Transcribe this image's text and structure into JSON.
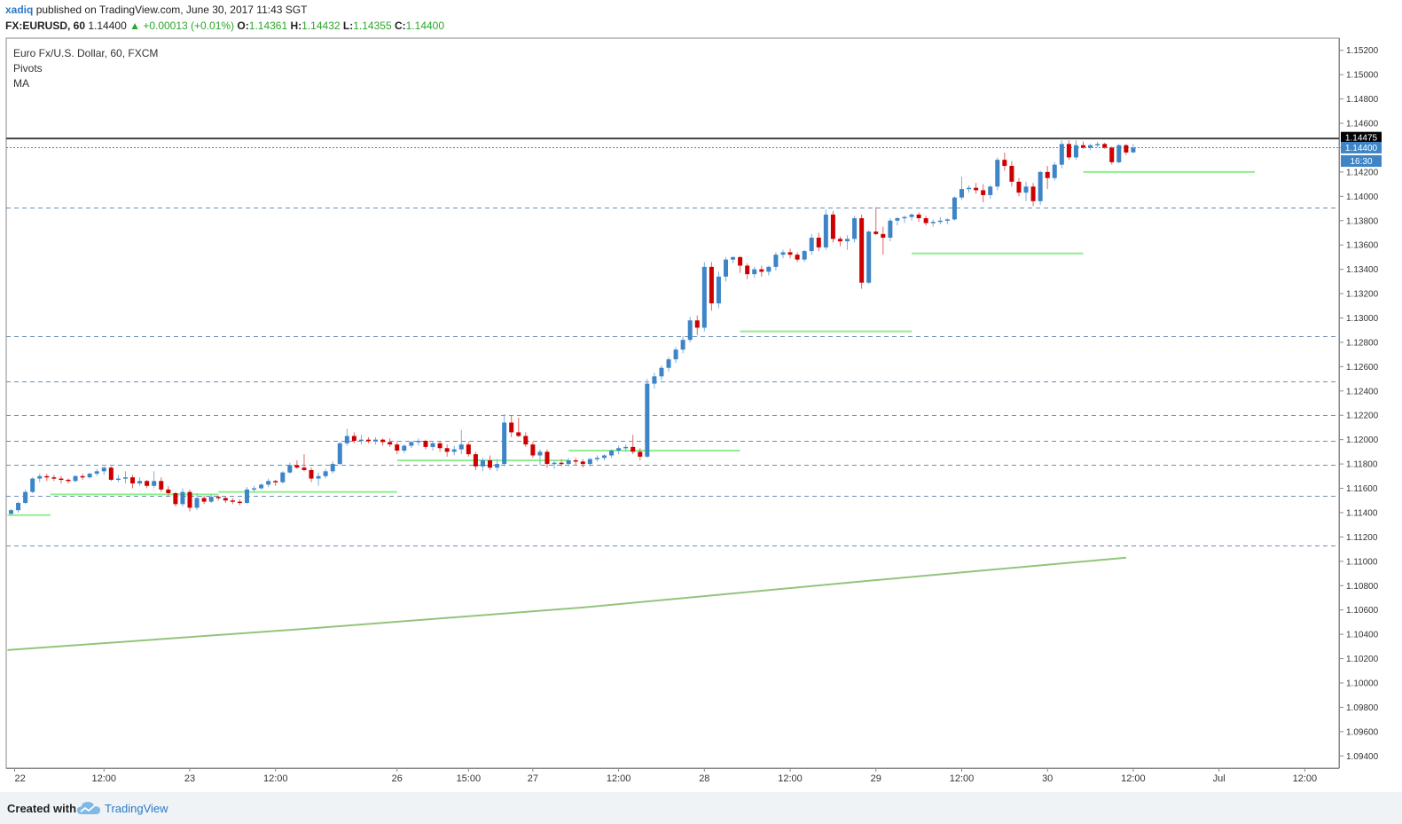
{
  "header": {
    "user": "xadiq",
    "published": "published on TradingView.com, June 30, 2017 11:43 SGT",
    "symbol": "FX:EURUSD, 60",
    "last": "1.14400",
    "change": "▲ +0.00013 (+0.01%)",
    "o_label": "O:",
    "o_value": "1.14361",
    "h_label": "H:",
    "h_value": "1.14432",
    "l_label": "L:",
    "l_value": "1.14355",
    "c_label": "C:",
    "c_value": "1.14400"
  },
  "legend": {
    "title": "Euro Fx/U.S. Dollar, 60, FXCM",
    "indicator1": "Pivots",
    "indicator2": "MA"
  },
  "footer": {
    "created": "Created with",
    "brand": "TradingView"
  },
  "colors": {
    "up": "#3d85c6",
    "down": "#cc0000",
    "wick_up": "#7aaee0",
    "wick_down": "#e06666",
    "pivot": "#90ee90",
    "ma": "#93c47d",
    "dashed": "#6d8fb0",
    "resistance": "#434343"
  },
  "chart_data": {
    "type": "candlestick",
    "symbol": "FX:EURUSD",
    "interval": "60",
    "ylim": [
      1.093,
      1.153
    ],
    "yticks": [
      "1.15200",
      "1.15000",
      "1.14800",
      "1.14600",
      "1.14400",
      "1.14200",
      "1.14000",
      "1.13800",
      "1.13600",
      "1.13400",
      "1.13200",
      "1.13000",
      "1.12800",
      "1.12600",
      "1.12400",
      "1.12200",
      "1.12000",
      "1.11800",
      "1.11600",
      "1.11400",
      "1.11200",
      "1.11000",
      "1.10800",
      "1.10600",
      "1.10400",
      "1.10200",
      "1.10000",
      "1.09800",
      "1.09600",
      "1.09400"
    ],
    "xlim": [
      0,
      157
    ],
    "xticks": [
      {
        "i": 0.5,
        "label": "22"
      },
      {
        "i": 13,
        "label": "12:00"
      },
      {
        "i": 25,
        "label": "23"
      },
      {
        "i": 37,
        "label": "12:00"
      },
      {
        "i": 54,
        "label": "26"
      },
      {
        "i": 64,
        "label": "15:00"
      },
      {
        "i": 73,
        "label": "27"
      },
      {
        "i": 85,
        "label": "12:00"
      },
      {
        "i": 97,
        "label": "28"
      },
      {
        "i": 109,
        "label": "12:00"
      },
      {
        "i": 121,
        "label": "29"
      },
      {
        "i": 133,
        "label": "12:00"
      },
      {
        "i": 145,
        "label": "30"
      },
      {
        "i": 157,
        "label": "12:00"
      },
      {
        "i": 169,
        "label": "Jul"
      },
      {
        "i": 181,
        "label": "12:00"
      }
    ],
    "price_markers": [
      {
        "label": "1.14475",
        "value": 1.14475,
        "bg": "#000000",
        "fg": "#ffffff"
      },
      {
        "label": "1.14400",
        "value": 1.144,
        "bg": "#3d85c6",
        "fg": "#ffffff"
      },
      {
        "label": "16:30",
        "value": 1.1429,
        "bg": "#3d85c6",
        "fg": "#ffffff"
      }
    ],
    "resistance": 1.14475,
    "last_price": 1.144,
    "dashed_levels": [
      1.1391,
      1.1285,
      1.1248,
      1.122,
      1.1199,
      1.1179,
      1.1154,
      1.1113
    ],
    "pivots": [
      {
        "from": -0.5,
        "to": 5.5,
        "value": 1.1138
      },
      {
        "from": 5.5,
        "to": 29,
        "value": 1.1155
      },
      {
        "from": 29,
        "to": 54,
        "value": 1.1157
      },
      {
        "from": 54,
        "to": 78,
        "value": 1.1183
      },
      {
        "from": 78,
        "to": 102,
        "value": 1.1191
      },
      {
        "from": 102,
        "to": 126,
        "value": 1.1289
      },
      {
        "from": 126,
        "to": 150,
        "value": 1.1353
      },
      {
        "from": 150,
        "to": 174,
        "value": 1.142
      }
    ],
    "ma": [
      {
        "i": -0.5,
        "value": 1.1027
      },
      {
        "i": 40,
        "value": 1.1044
      },
      {
        "i": 80,
        "value": 1.1062
      },
      {
        "i": 120,
        "value": 1.1084
      },
      {
        "i": 156,
        "value": 1.1103
      }
    ],
    "candles": [
      [
        1.1139,
        1.1143,
        1.1138,
        1.1142
      ],
      [
        1.1142,
        1.1149,
        1.114,
        1.1148
      ],
      [
        1.1148,
        1.1159,
        1.1147,
        1.1157
      ],
      [
        1.1157,
        1.1169,
        1.1156,
        1.1168
      ],
      [
        1.1168,
        1.1172,
        1.1165,
        1.117
      ],
      [
        1.117,
        1.1172,
        1.1166,
        1.1169
      ],
      [
        1.1169,
        1.1171,
        1.1166,
        1.1168
      ],
      [
        1.1168,
        1.117,
        1.1164,
        1.1167
      ],
      [
        1.1167,
        1.1168,
        1.1164,
        1.1166
      ],
      [
        1.1166,
        1.1171,
        1.1165,
        1.117
      ],
      [
        1.117,
        1.1172,
        1.1167,
        1.1169
      ],
      [
        1.1169,
        1.1173,
        1.1168,
        1.1172
      ],
      [
        1.1172,
        1.1176,
        1.117,
        1.1174
      ],
      [
        1.1174,
        1.1178,
        1.1171,
        1.1177
      ],
      [
        1.1177,
        1.1178,
        1.1166,
        1.1167
      ],
      [
        1.1167,
        1.1171,
        1.1165,
        1.1168
      ],
      [
        1.1168,
        1.1174,
        1.1164,
        1.1169
      ],
      [
        1.1169,
        1.1171,
        1.116,
        1.1164
      ],
      [
        1.1164,
        1.1169,
        1.1162,
        1.1166
      ],
      [
        1.1166,
        1.1167,
        1.116,
        1.1162
      ],
      [
        1.1162,
        1.1174,
        1.116,
        1.1166
      ],
      [
        1.1166,
        1.1169,
        1.1157,
        1.1159
      ],
      [
        1.1159,
        1.1162,
        1.1154,
        1.1156
      ],
      [
        1.1156,
        1.1157,
        1.1145,
        1.1147
      ],
      [
        1.1147,
        1.116,
        1.1145,
        1.1157
      ],
      [
        1.1157,
        1.1159,
        1.1141,
        1.1144
      ],
      [
        1.1144,
        1.1156,
        1.1142,
        1.1152
      ],
      [
        1.1152,
        1.1154,
        1.1147,
        1.1149
      ],
      [
        1.1149,
        1.1155,
        1.1148,
        1.1153
      ],
      [
        1.1153,
        1.1154,
        1.115,
        1.1152
      ],
      [
        1.1152,
        1.1153,
        1.1148,
        1.115
      ],
      [
        1.115,
        1.1152,
        1.1147,
        1.1149
      ],
      [
        1.1149,
        1.1151,
        1.1146,
        1.1148
      ],
      [
        1.1148,
        1.1161,
        1.1147,
        1.1159
      ],
      [
        1.1159,
        1.1162,
        1.1157,
        1.116
      ],
      [
        1.116,
        1.1164,
        1.1159,
        1.1163
      ],
      [
        1.1163,
        1.1168,
        1.1161,
        1.1166
      ],
      [
        1.1166,
        1.1167,
        1.1162,
        1.1165
      ],
      [
        1.1165,
        1.1174,
        1.1164,
        1.1173
      ],
      [
        1.1173,
        1.1181,
        1.1172,
        1.1179
      ],
      [
        1.1179,
        1.1183,
        1.1176,
        1.1177
      ],
      [
        1.1177,
        1.1188,
        1.1174,
        1.1175
      ],
      [
        1.1175,
        1.1177,
        1.1165,
        1.1168
      ],
      [
        1.1168,
        1.1173,
        1.1162,
        1.117
      ],
      [
        1.117,
        1.1176,
        1.1168,
        1.1174
      ],
      [
        1.1174,
        1.1182,
        1.1172,
        1.118
      ],
      [
        1.118,
        1.1198,
        1.1179,
        1.1197
      ],
      [
        1.1197,
        1.1209,
        1.1195,
        1.1203
      ],
      [
        1.1203,
        1.1206,
        1.1197,
        1.1199
      ],
      [
        1.1199,
        1.1204,
        1.1196,
        1.12
      ],
      [
        1.12,
        1.1202,
        1.1197,
        1.1199
      ],
      [
        1.1199,
        1.1202,
        1.1196,
        1.12
      ],
      [
        1.12,
        1.1201,
        1.1195,
        1.1198
      ],
      [
        1.1198,
        1.1201,
        1.1194,
        1.1196
      ],
      [
        1.1196,
        1.1198,
        1.1188,
        1.1191
      ],
      [
        1.1191,
        1.1196,
        1.1189,
        1.1195
      ],
      [
        1.1195,
        1.1199,
        1.1193,
        1.1198
      ],
      [
        1.1198,
        1.1201,
        1.1195,
        1.1199
      ],
      [
        1.1199,
        1.12,
        1.1192,
        1.1194
      ],
      [
        1.1194,
        1.1199,
        1.1191,
        1.1197
      ],
      [
        1.1197,
        1.1199,
        1.119,
        1.1193
      ],
      [
        1.1193,
        1.1196,
        1.1186,
        1.119
      ],
      [
        1.119,
        1.1195,
        1.1187,
        1.1192
      ],
      [
        1.1192,
        1.1208,
        1.1188,
        1.1196
      ],
      [
        1.1196,
        1.1198,
        1.1186,
        1.1188
      ],
      [
        1.1188,
        1.119,
        1.1175,
        1.1178
      ],
      [
        1.1178,
        1.1185,
        1.1174,
        1.1183
      ],
      [
        1.1183,
        1.1187,
        1.1175,
        1.1177
      ],
      [
        1.1177,
        1.1184,
        1.1174,
        1.118
      ],
      [
        1.118,
        1.1221,
        1.1178,
        1.1214
      ],
      [
        1.1214,
        1.122,
        1.1202,
        1.1206
      ],
      [
        1.1206,
        1.1218,
        1.1202,
        1.1203
      ],
      [
        1.1203,
        1.1206,
        1.1194,
        1.1196
      ],
      [
        1.1196,
        1.1198,
        1.1185,
        1.1187
      ],
      [
        1.1187,
        1.1192,
        1.1179,
        1.119
      ],
      [
        1.119,
        1.1192,
        1.1177,
        1.118
      ],
      [
        1.118,
        1.1183,
        1.1176,
        1.1181
      ],
      [
        1.1181,
        1.1184,
        1.1178,
        1.118
      ],
      [
        1.118,
        1.1185,
        1.1178,
        1.1183
      ],
      [
        1.1183,
        1.1185,
        1.1179,
        1.1182
      ],
      [
        1.1182,
        1.1184,
        1.1177,
        1.118
      ],
      [
        1.118,
        1.1185,
        1.1178,
        1.1184
      ],
      [
        1.1184,
        1.1187,
        1.1182,
        1.1185
      ],
      [
        1.1185,
        1.1188,
        1.1183,
        1.1187
      ],
      [
        1.1187,
        1.1192,
        1.1185,
        1.1191
      ],
      [
        1.1191,
        1.1195,
        1.1188,
        1.1193
      ],
      [
        1.1193,
        1.1196,
        1.119,
        1.1194
      ],
      [
        1.1194,
        1.1204,
        1.1188,
        1.119
      ],
      [
        1.119,
        1.1193,
        1.1183,
        1.1186
      ],
      [
        1.1186,
        1.125,
        1.1185,
        1.1246
      ],
      [
        1.1246,
        1.1255,
        1.1242,
        1.1252
      ],
      [
        1.1252,
        1.1261,
        1.1249,
        1.1259
      ],
      [
        1.1259,
        1.1268,
        1.1256,
        1.1266
      ],
      [
        1.1266,
        1.1276,
        1.1263,
        1.1274
      ],
      [
        1.1274,
        1.1285,
        1.1271,
        1.1282
      ],
      [
        1.1282,
        1.1301,
        1.128,
        1.1298
      ],
      [
        1.1298,
        1.1302,
        1.1286,
        1.1292
      ],
      [
        1.1292,
        1.1346,
        1.1289,
        1.1342
      ],
      [
        1.1342,
        1.1346,
        1.1306,
        1.1312
      ],
      [
        1.1312,
        1.1338,
        1.1308,
        1.1334
      ],
      [
        1.1334,
        1.135,
        1.133,
        1.1348
      ],
      [
        1.1348,
        1.1351,
        1.1345,
        1.135
      ],
      [
        1.135,
        1.1351,
        1.1337,
        1.1343
      ],
      [
        1.1343,
        1.1345,
        1.1332,
        1.1336
      ],
      [
        1.1336,
        1.1342,
        1.1333,
        1.134
      ],
      [
        1.134,
        1.1343,
        1.1334,
        1.1338
      ],
      [
        1.1338,
        1.1343,
        1.1335,
        1.1342
      ],
      [
        1.1342,
        1.1354,
        1.1339,
        1.1352
      ],
      [
        1.1352,
        1.1356,
        1.1349,
        1.1354
      ],
      [
        1.1354,
        1.1357,
        1.1349,
        1.1352
      ],
      [
        1.1352,
        1.1354,
        1.1346,
        1.1348
      ],
      [
        1.1348,
        1.1356,
        1.1346,
        1.1355
      ],
      [
        1.1355,
        1.1369,
        1.1352,
        1.1366
      ],
      [
        1.1366,
        1.137,
        1.1355,
        1.1358
      ],
      [
        1.1358,
        1.1389,
        1.1356,
        1.1385
      ],
      [
        1.1385,
        1.1388,
        1.1362,
        1.1365
      ],
      [
        1.1365,
        1.1367,
        1.1359,
        1.1363
      ],
      [
        1.1363,
        1.1368,
        1.1356,
        1.1365
      ],
      [
        1.1365,
        1.1384,
        1.1362,
        1.1382
      ],
      [
        1.1382,
        1.1385,
        1.1324,
        1.1329
      ],
      [
        1.1329,
        1.1372,
        1.1328,
        1.1371
      ],
      [
        1.1371,
        1.1391,
        1.1368,
        1.1369
      ],
      [
        1.1369,
        1.1375,
        1.1352,
        1.1366
      ],
      [
        1.1366,
        1.1382,
        1.1363,
        1.138
      ],
      [
        1.138,
        1.1383,
        1.1376,
        1.1382
      ],
      [
        1.1382,
        1.1384,
        1.1378,
        1.1383
      ],
      [
        1.1383,
        1.1386,
        1.138,
        1.1385
      ],
      [
        1.1385,
        1.1387,
        1.1379,
        1.1382
      ],
      [
        1.1382,
        1.1384,
        1.1376,
        1.1378
      ],
      [
        1.1378,
        1.1381,
        1.1375,
        1.1379
      ],
      [
        1.1379,
        1.1383,
        1.1377,
        1.138
      ],
      [
        1.138,
        1.1382,
        1.1377,
        1.1381
      ],
      [
        1.1381,
        1.14,
        1.138,
        1.1399
      ],
      [
        1.1399,
        1.1416,
        1.1397,
        1.1406
      ],
      [
        1.1406,
        1.1409,
        1.1403,
        1.1407
      ],
      [
        1.1407,
        1.1411,
        1.1402,
        1.1405
      ],
      [
        1.1405,
        1.141,
        1.1395,
        1.1401
      ],
      [
        1.1401,
        1.1409,
        1.1398,
        1.1408
      ],
      [
        1.1408,
        1.1432,
        1.1405,
        1.143
      ],
      [
        1.143,
        1.1436,
        1.1421,
        1.1425
      ],
      [
        1.1425,
        1.1429,
        1.1408,
        1.1412
      ],
      [
        1.1412,
        1.1415,
        1.14,
        1.1403
      ],
      [
        1.1403,
        1.1412,
        1.1396,
        1.1408
      ],
      [
        1.1408,
        1.1411,
        1.1392,
        1.1396
      ],
      [
        1.1396,
        1.1421,
        1.1393,
        1.142
      ],
      [
        1.142,
        1.1425,
        1.1406,
        1.1415
      ],
      [
        1.1415,
        1.1428,
        1.1413,
        1.1426
      ],
      [
        1.1426,
        1.1446,
        1.1423,
        1.1443
      ],
      [
        1.1443,
        1.1446,
        1.143,
        1.1432
      ],
      [
        1.1432,
        1.1446,
        1.143,
        1.1442
      ],
      [
        1.1442,
        1.1445,
        1.1439,
        1.144
      ],
      [
        1.144,
        1.1443,
        1.1438,
        1.1442
      ],
      [
        1.1442,
        1.1445,
        1.144,
        1.1443
      ],
      [
        1.1443,
        1.1444,
        1.1439,
        1.144
      ],
      [
        1.144,
        1.1441,
        1.1426,
        1.1428
      ],
      [
        1.1428,
        1.1443,
        1.1427,
        1.1442
      ],
      [
        1.1442,
        1.1443,
        1.1434,
        1.1436
      ],
      [
        1.14361,
        1.14432,
        1.14355,
        1.144
      ]
    ]
  }
}
